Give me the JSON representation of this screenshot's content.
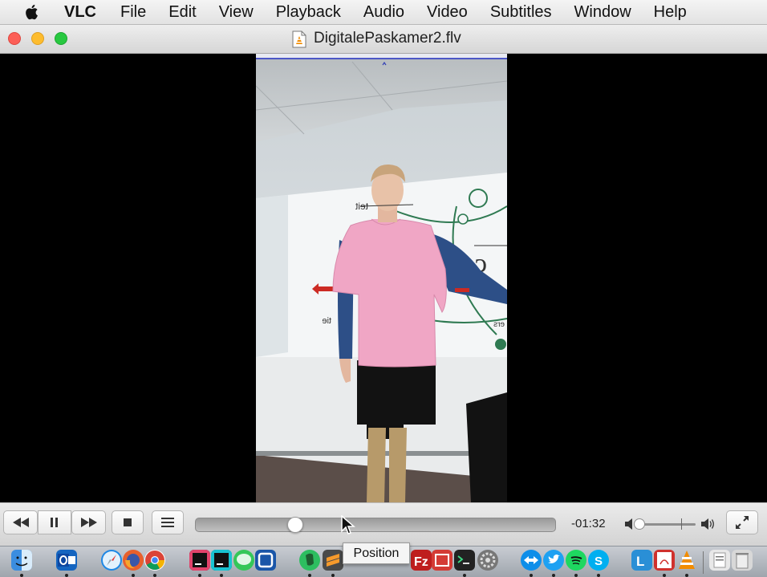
{
  "menu": {
    "apple_icon": "apple-logo-icon",
    "app_name": "VLC",
    "items": [
      "File",
      "Edit",
      "View",
      "Playback",
      "Audio",
      "Video",
      "Subtitles",
      "Window",
      "Help"
    ]
  },
  "window": {
    "title": "DigitalePaskamer2.flv",
    "file_icon": "vlc-file-icon"
  },
  "player": {
    "time_remaining": "-01:32",
    "playback_position": 0.28,
    "volume_level": 0.04,
    "buttons": {
      "rewind": "rewind-icon",
      "pause": "pause-icon",
      "fast_forward": "fast-forward-icon",
      "stop": "stop-icon",
      "playlist": "playlist-icon",
      "fullscreen": "fullscreen-icon"
    },
    "tooltip": "Position"
  },
  "dock": {
    "icons": [
      {
        "name": "finder-icon",
        "color": "#3b8de0"
      },
      {
        "name": "outlook-icon",
        "color": "#1565c0"
      },
      {
        "name": "safari-icon",
        "color": "#1e88e5"
      },
      {
        "name": "firefox-icon",
        "color": "#e8602c"
      },
      {
        "name": "chrome-icon",
        "color": "#4caf50"
      },
      {
        "name": "intellij-icon",
        "color": "#1b1b1b"
      },
      {
        "name": "webstorm-icon",
        "color": "#1f3b4d"
      },
      {
        "name": "messages-icon",
        "color": "#34c759"
      },
      {
        "name": "sourcetree-icon",
        "color": "#1a56a8"
      },
      {
        "name": "evernote-icon",
        "color": "#2dbe60"
      },
      {
        "name": "sublime-icon",
        "color": "#4a4a4a"
      },
      {
        "name": "filezilla-icon",
        "color": "#bf1e1e"
      },
      {
        "name": "app-red-icon",
        "color": "#d43b35"
      },
      {
        "name": "terminal-icon",
        "color": "#222222"
      },
      {
        "name": "system-preferences-icon",
        "color": "#777777"
      },
      {
        "name": "teamviewer-icon",
        "color": "#0e8ee9"
      },
      {
        "name": "twitter-icon",
        "color": "#1da1f2"
      },
      {
        "name": "spotify-icon",
        "color": "#1ed760"
      },
      {
        "name": "skype-icon",
        "color": "#00aff0"
      },
      {
        "name": "lync-icon",
        "color": "#2a8fd6"
      },
      {
        "name": "acrobat-icon",
        "color": "#d0312d"
      },
      {
        "name": "vlc-icon",
        "color": "#f28c00"
      },
      {
        "name": "documents-icon",
        "color": "#e8e8e8"
      },
      {
        "name": "trash-icon",
        "color": "#d8d8d8"
      }
    ]
  }
}
